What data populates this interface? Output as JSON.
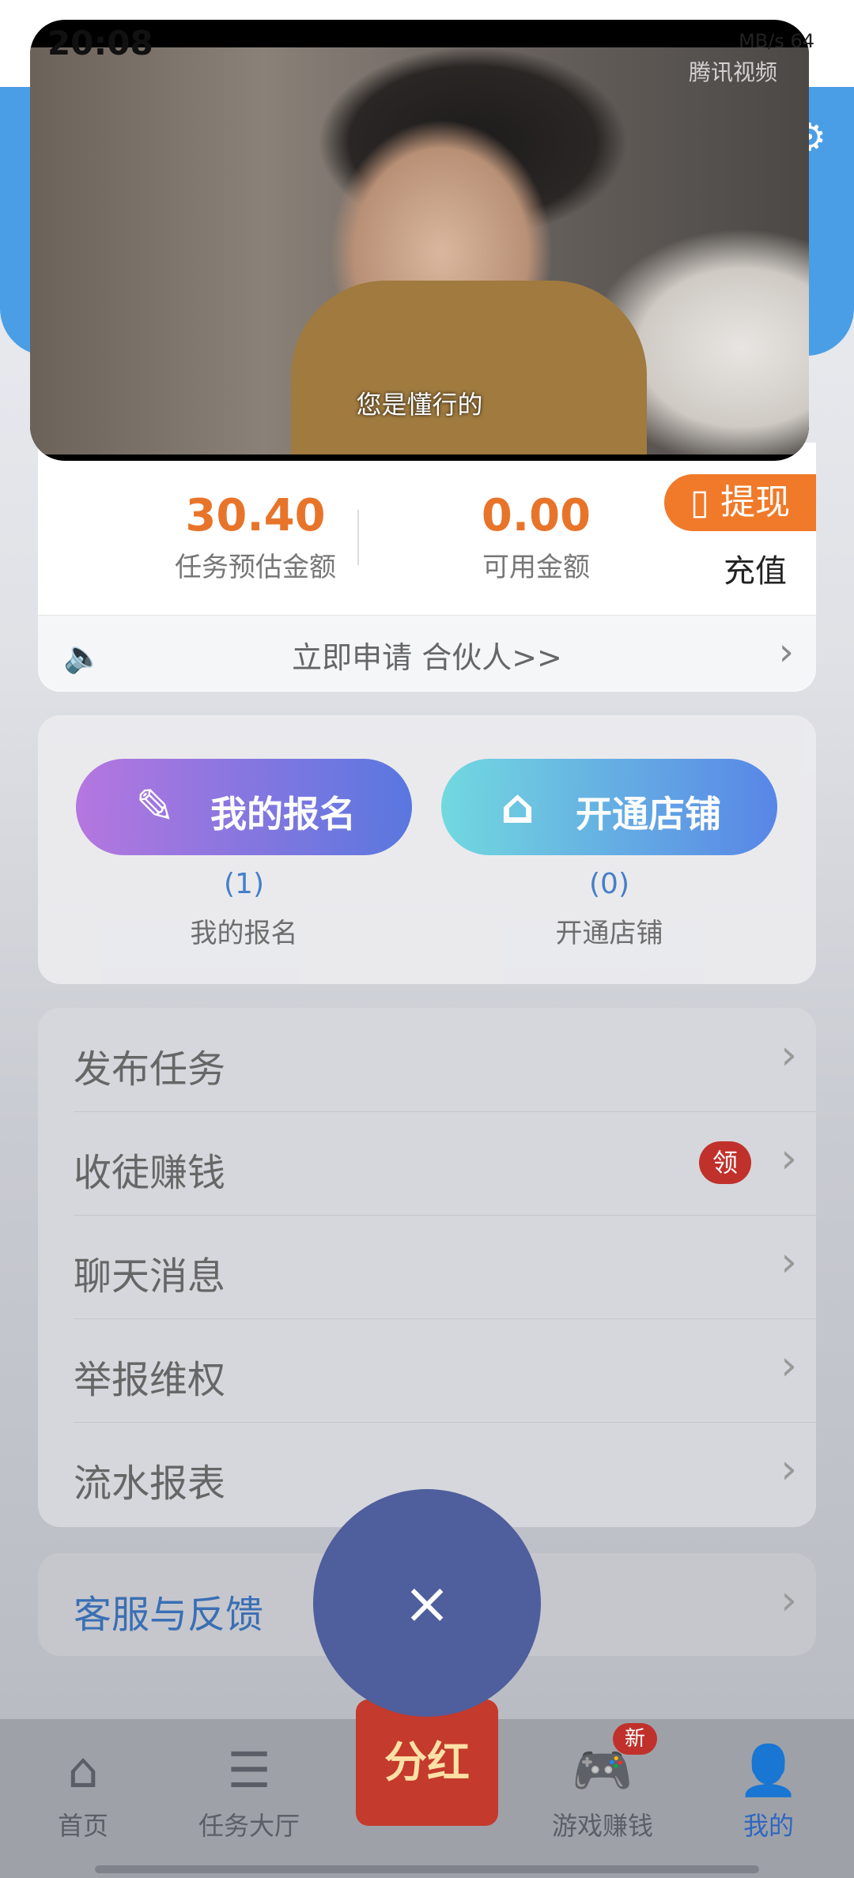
{
  "status_bar": {
    "time": "20:08",
    "right": "MB/s  64"
  },
  "video": {
    "subtitle": "您是懂行的",
    "brand": "腾讯视频"
  },
  "amounts": {
    "task_estimate_value": "30.40",
    "task_estimate_label": "任务预估金额",
    "available_value": "0.00",
    "available_label": "可用金额",
    "withdraw_label": "提现",
    "recharge_label": "充值"
  },
  "notice": {
    "text": "立即申请 合伙人>>"
  },
  "actions": {
    "signup": {
      "label": "我的报名",
      "count": "(1)",
      "sub": "我的报名"
    },
    "store": {
      "label": "开通店铺",
      "count": "(0)",
      "sub": "开通店铺"
    }
  },
  "menu": {
    "items": [
      {
        "label": "发布任务"
      },
      {
        "label": "收徒赚钱",
        "badge": "领"
      },
      {
        "label": "聊天消息"
      },
      {
        "label": "举报维权"
      },
      {
        "label": "流水报表"
      }
    ]
  },
  "service": {
    "label": "客服与反馈"
  },
  "overlay": {
    "close": "×"
  },
  "nav": {
    "home": "首页",
    "tasks": "任务大厅",
    "bonus": "分红",
    "games": "游戏赚钱",
    "games_badge": "新",
    "mine": "我的"
  },
  "colors": {
    "accent_orange": "#e8742a",
    "brand_blue": "#4a9ee6",
    "badge_red": "#c0312b"
  }
}
